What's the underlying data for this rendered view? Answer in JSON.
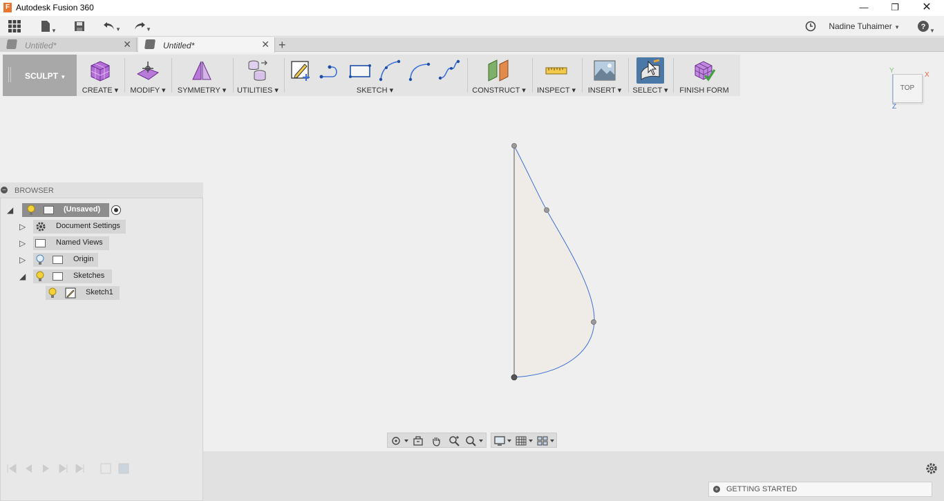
{
  "window": {
    "title": "Autodesk Fusion 360",
    "logo_letter": "F"
  },
  "appbar": {
    "user_name": "Nadine Tuhaimer"
  },
  "tabs": [
    {
      "label": "Untitled*",
      "active": false
    },
    {
      "label": "Untitled*",
      "active": true
    }
  ],
  "toolbar": {
    "workspace": "SCULPT",
    "groups": {
      "create": "CREATE",
      "modify": "MODIFY",
      "symmetry": "SYMMETRY",
      "utilities": "UTILITIES",
      "sketch": "SKETCH",
      "construct": "CONSTRUCT",
      "inspect": "INSPECT",
      "insert": "INSERT",
      "select": "SELECT",
      "finish_form": "FINISH FORM"
    }
  },
  "viewcube": {
    "face": "TOP",
    "axis_x": "X",
    "axis_y": "Y",
    "axis_z": "Z"
  },
  "browser": {
    "title": "BROWSER",
    "root": "(Unsaved)",
    "items": [
      {
        "label": "Document Settings",
        "icon": "gear-icon"
      },
      {
        "label": "Named Views",
        "icon": "folder-icon"
      },
      {
        "label": "Origin",
        "icon": "folder-icon"
      },
      {
        "label": "Sketches",
        "icon": "folder-icon"
      },
      {
        "label": "Sketch1",
        "icon": "sketch-icon"
      }
    ]
  },
  "getting_started": "GETTING STARTED",
  "colors": {
    "accent_select": "#4a79a8",
    "sketch_curve": "#3b6fd6",
    "sketch_fill": "#efebe6",
    "bulb": "#f2d13a"
  }
}
